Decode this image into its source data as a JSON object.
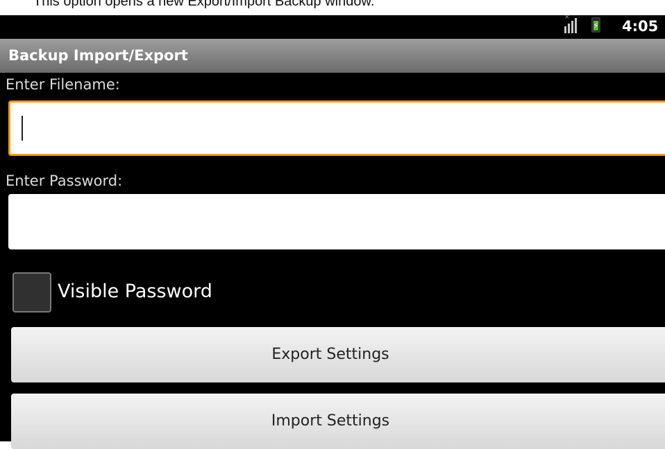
{
  "caption": "This option opens a new Export/Import Backup window.",
  "status_bar": {
    "time": "4:05",
    "signal_icon": "signal-icon",
    "battery_icon": "battery-charging-icon"
  },
  "title_bar": {
    "title": "Backup Import/Export"
  },
  "form": {
    "filename_label": "Enter Filename:",
    "filename_value": "",
    "password_label": "Enter Password:",
    "password_value": "",
    "visible_password_label": "Visible Password",
    "visible_password_checked": false
  },
  "buttons": {
    "export": "Export Settings",
    "import": "Import Settings"
  },
  "colors": {
    "focus_accent": "#f39a1b",
    "title_bar": "#8a8a8a",
    "battery_green": "#5ab93a"
  }
}
